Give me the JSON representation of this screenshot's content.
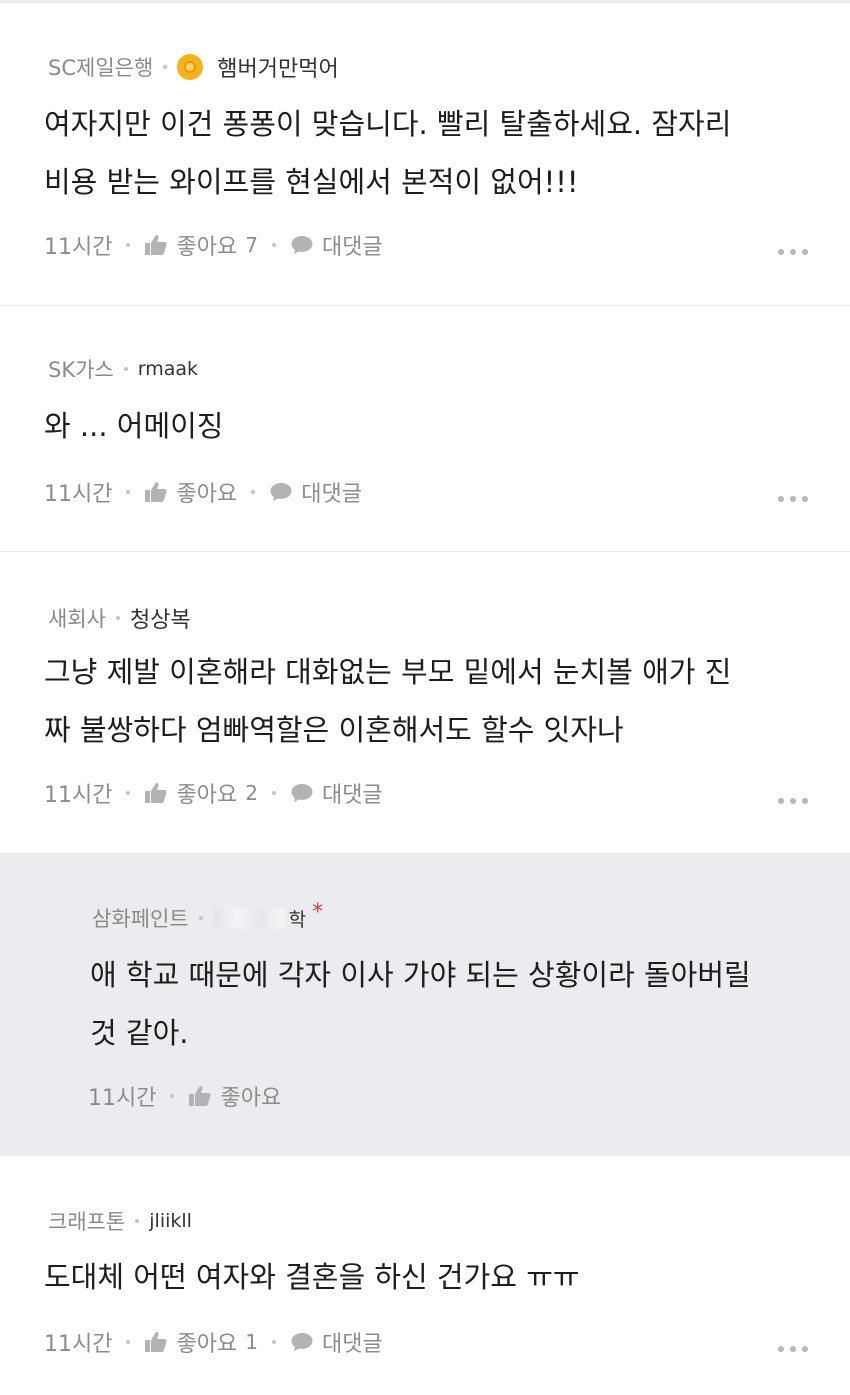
{
  "comments": [
    {
      "company": "SC제일은행",
      "nickname": "햄버거만먹어",
      "text_lines": [
        "여자지만 이건 퐁퐁이 맞습니다. 빨리 탈출하세요. 잠자리",
        "비용 받는 와이프를 현실에서 본적이 없어!!!"
      ],
      "time": "11시간",
      "like_label": "좋아요",
      "like_count": "7",
      "reply_label": "대댓글"
    },
    {
      "company": "SK가스",
      "nickname": "rmaak",
      "text_lines": [
        "와 ... 어메이징"
      ],
      "time": "11시간",
      "like_label": "좋아요",
      "like_count": "",
      "reply_label": "대댓글"
    },
    {
      "company": "새회사",
      "nickname": "청상복",
      "text_lines": [
        "그냥 제발 이혼해라 대화없는 부모 밑에서 눈치볼 애가 진",
        "짜 불쌍하다 엄빠역할은 이혼해서도 할수 잇자나"
      ],
      "time": "11시간",
      "like_label": "좋아요",
      "like_count": "2",
      "reply_label": "대댓글"
    },
    {
      "company": "삼화페인트",
      "nickname": "학",
      "required_mark": "*",
      "text_lines": [
        "애 학교 때문에 각자 이사 가야 되는 상황이라 돌아버릴",
        "것 같아."
      ],
      "time": "11시간",
      "like_label": "좋아요"
    },
    {
      "company": "크래프톤",
      "nickname": "jliikll",
      "text_lines": [
        "도대체 어떤 여자와 결혼을 하신 건가요 ㅠㅠ"
      ],
      "time": "11시간",
      "like_label": "좋아요",
      "like_count": "1",
      "reply_label": "대댓글"
    }
  ],
  "icons": {
    "like": "thumbs-up-icon",
    "reply": "speech-bubble-icon",
    "more": "more-options-icon",
    "badge": "emoji-badge-icon"
  },
  "colors": {
    "reply_bg": "#ebecf0",
    "badge": "#f6b21a",
    "required": "#d33a3a"
  }
}
